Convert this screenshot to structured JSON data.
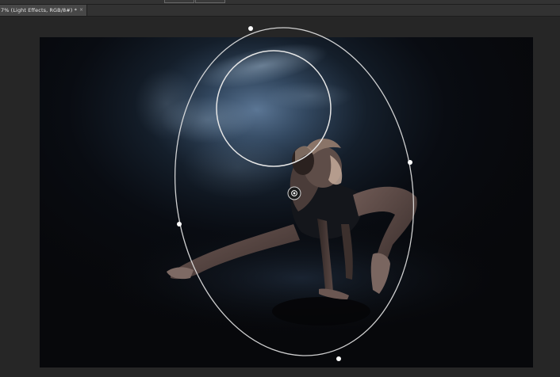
{
  "document": {
    "tab_title": "7% (Light Effects, RGB/8#) *",
    "close_glyph": "×"
  },
  "photo": {
    "subject": "dancer",
    "background_color": "#07080b",
    "light_color": "#5a7898"
  },
  "light_widget": {
    "ring_color": "#e8e8e8",
    "handle_color": "#ffffff",
    "center_icon": "target-icon"
  }
}
